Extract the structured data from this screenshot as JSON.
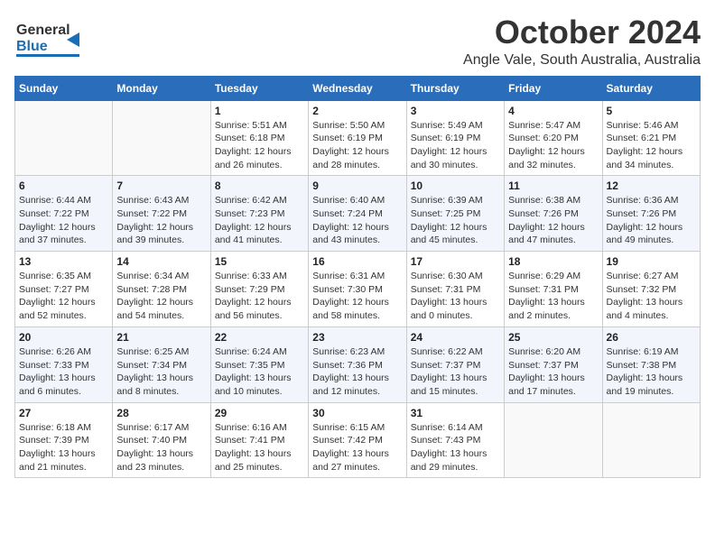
{
  "header": {
    "logo_general": "General",
    "logo_blue": "Blue",
    "month": "October 2024",
    "location": "Angle Vale, South Australia, Australia"
  },
  "days_of_week": [
    "Sunday",
    "Monday",
    "Tuesday",
    "Wednesday",
    "Thursday",
    "Friday",
    "Saturday"
  ],
  "weeks": [
    [
      {
        "day": "",
        "info": ""
      },
      {
        "day": "",
        "info": ""
      },
      {
        "day": "1",
        "info": "Sunrise: 5:51 AM\nSunset: 6:18 PM\nDaylight: 12 hours\nand 26 minutes."
      },
      {
        "day": "2",
        "info": "Sunrise: 5:50 AM\nSunset: 6:19 PM\nDaylight: 12 hours\nand 28 minutes."
      },
      {
        "day": "3",
        "info": "Sunrise: 5:49 AM\nSunset: 6:19 PM\nDaylight: 12 hours\nand 30 minutes."
      },
      {
        "day": "4",
        "info": "Sunrise: 5:47 AM\nSunset: 6:20 PM\nDaylight: 12 hours\nand 32 minutes."
      },
      {
        "day": "5",
        "info": "Sunrise: 5:46 AM\nSunset: 6:21 PM\nDaylight: 12 hours\nand 34 minutes."
      }
    ],
    [
      {
        "day": "6",
        "info": "Sunrise: 6:44 AM\nSunset: 7:22 PM\nDaylight: 12 hours\nand 37 minutes."
      },
      {
        "day": "7",
        "info": "Sunrise: 6:43 AM\nSunset: 7:22 PM\nDaylight: 12 hours\nand 39 minutes."
      },
      {
        "day": "8",
        "info": "Sunrise: 6:42 AM\nSunset: 7:23 PM\nDaylight: 12 hours\nand 41 minutes."
      },
      {
        "day": "9",
        "info": "Sunrise: 6:40 AM\nSunset: 7:24 PM\nDaylight: 12 hours\nand 43 minutes."
      },
      {
        "day": "10",
        "info": "Sunrise: 6:39 AM\nSunset: 7:25 PM\nDaylight: 12 hours\nand 45 minutes."
      },
      {
        "day": "11",
        "info": "Sunrise: 6:38 AM\nSunset: 7:26 PM\nDaylight: 12 hours\nand 47 minutes."
      },
      {
        "day": "12",
        "info": "Sunrise: 6:36 AM\nSunset: 7:26 PM\nDaylight: 12 hours\nand 49 minutes."
      }
    ],
    [
      {
        "day": "13",
        "info": "Sunrise: 6:35 AM\nSunset: 7:27 PM\nDaylight: 12 hours\nand 52 minutes."
      },
      {
        "day": "14",
        "info": "Sunrise: 6:34 AM\nSunset: 7:28 PM\nDaylight: 12 hours\nand 54 minutes."
      },
      {
        "day": "15",
        "info": "Sunrise: 6:33 AM\nSunset: 7:29 PM\nDaylight: 12 hours\nand 56 minutes."
      },
      {
        "day": "16",
        "info": "Sunrise: 6:31 AM\nSunset: 7:30 PM\nDaylight: 12 hours\nand 58 minutes."
      },
      {
        "day": "17",
        "info": "Sunrise: 6:30 AM\nSunset: 7:31 PM\nDaylight: 13 hours\nand 0 minutes."
      },
      {
        "day": "18",
        "info": "Sunrise: 6:29 AM\nSunset: 7:31 PM\nDaylight: 13 hours\nand 2 minutes."
      },
      {
        "day": "19",
        "info": "Sunrise: 6:27 AM\nSunset: 7:32 PM\nDaylight: 13 hours\nand 4 minutes."
      }
    ],
    [
      {
        "day": "20",
        "info": "Sunrise: 6:26 AM\nSunset: 7:33 PM\nDaylight: 13 hours\nand 6 minutes."
      },
      {
        "day": "21",
        "info": "Sunrise: 6:25 AM\nSunset: 7:34 PM\nDaylight: 13 hours\nand 8 minutes."
      },
      {
        "day": "22",
        "info": "Sunrise: 6:24 AM\nSunset: 7:35 PM\nDaylight: 13 hours\nand 10 minutes."
      },
      {
        "day": "23",
        "info": "Sunrise: 6:23 AM\nSunset: 7:36 PM\nDaylight: 13 hours\nand 12 minutes."
      },
      {
        "day": "24",
        "info": "Sunrise: 6:22 AM\nSunset: 7:37 PM\nDaylight: 13 hours\nand 15 minutes."
      },
      {
        "day": "25",
        "info": "Sunrise: 6:20 AM\nSunset: 7:37 PM\nDaylight: 13 hours\nand 17 minutes."
      },
      {
        "day": "26",
        "info": "Sunrise: 6:19 AM\nSunset: 7:38 PM\nDaylight: 13 hours\nand 19 minutes."
      }
    ],
    [
      {
        "day": "27",
        "info": "Sunrise: 6:18 AM\nSunset: 7:39 PM\nDaylight: 13 hours\nand 21 minutes."
      },
      {
        "day": "28",
        "info": "Sunrise: 6:17 AM\nSunset: 7:40 PM\nDaylight: 13 hours\nand 23 minutes."
      },
      {
        "day": "29",
        "info": "Sunrise: 6:16 AM\nSunset: 7:41 PM\nDaylight: 13 hours\nand 25 minutes."
      },
      {
        "day": "30",
        "info": "Sunrise: 6:15 AM\nSunset: 7:42 PM\nDaylight: 13 hours\nand 27 minutes."
      },
      {
        "day": "31",
        "info": "Sunrise: 6:14 AM\nSunset: 7:43 PM\nDaylight: 13 hours\nand 29 minutes."
      },
      {
        "day": "",
        "info": ""
      },
      {
        "day": "",
        "info": ""
      }
    ]
  ]
}
